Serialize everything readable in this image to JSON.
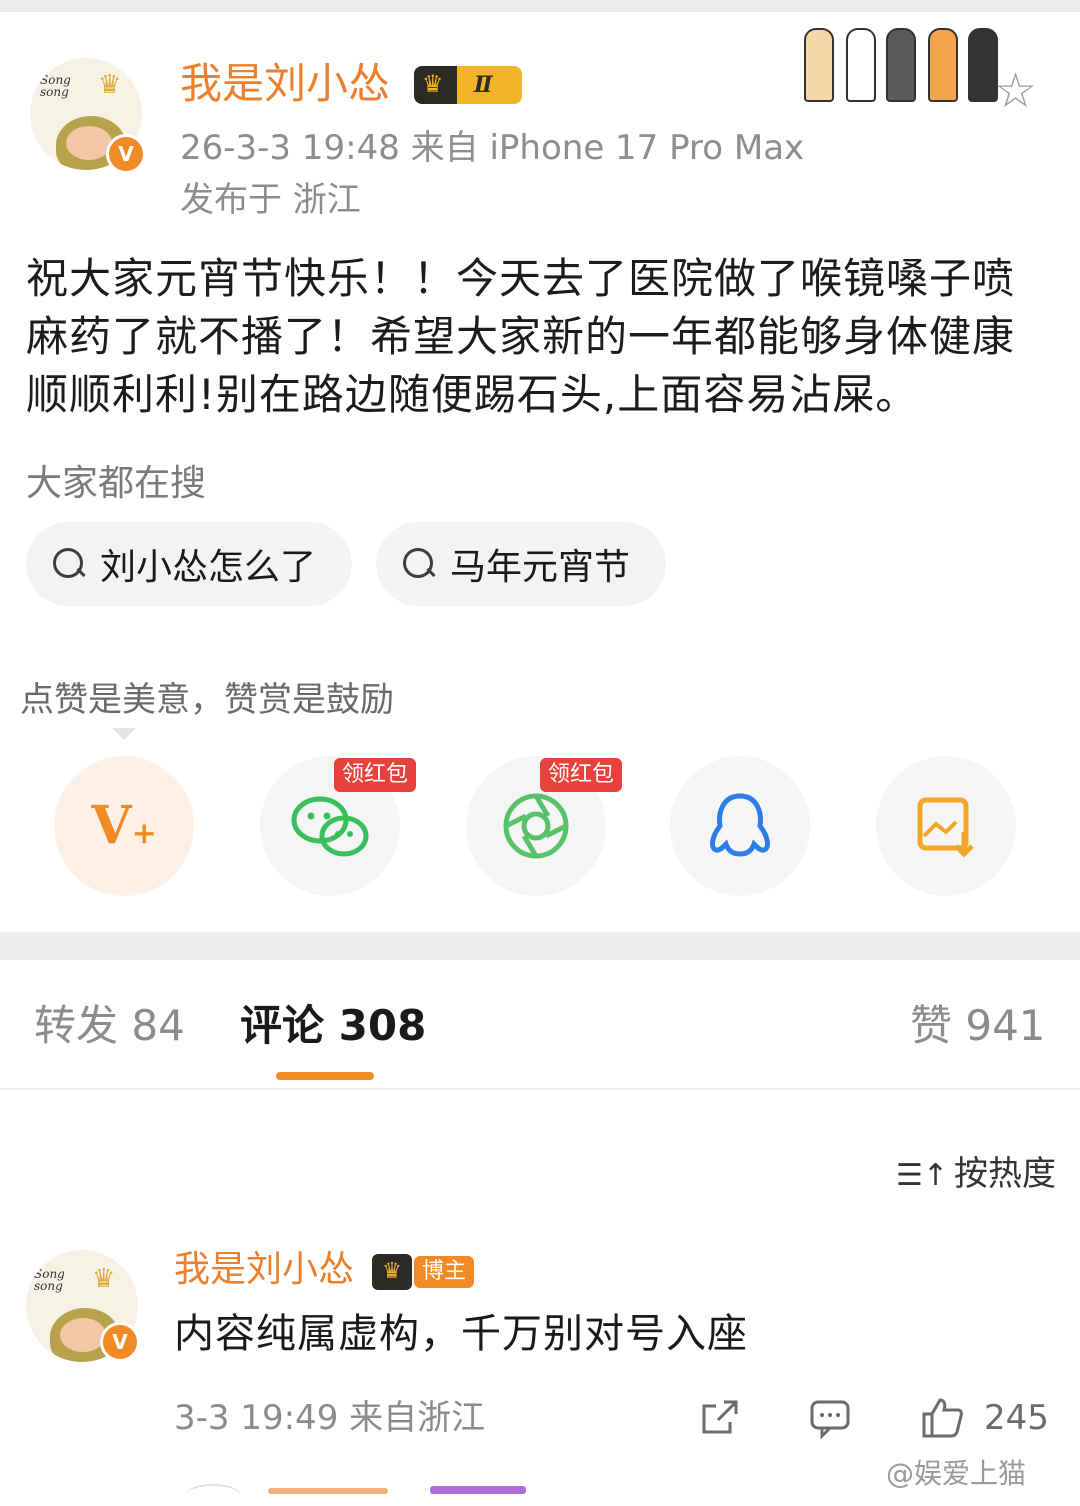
{
  "post": {
    "username": "我是刘小怂",
    "level": "Ⅱ",
    "time_source": "26-3-3 19:48  来自 iPhone 17 Pro Max",
    "location": "发布于 浙江",
    "content": "祝大家元宵节快乐！！今天去了医院做了喉镜嗓子喷麻药了就不播了！希望大家新的一年都能够身体健康顺顺利利!别在路边随便踢石头,上面容易沾屎。",
    "avatar_text": "song song"
  },
  "search": {
    "title": "大家都在搜",
    "chips": [
      "刘小怂怎么了",
      "马年元宵节"
    ]
  },
  "reward": {
    "tip": "点赞是美意，赞赏是鼓励",
    "red_packet_label": "领红包"
  },
  "share_icons": [
    "v-plus-icon",
    "wechat-icon",
    "moments-icon",
    "qq-icon",
    "save-image-icon"
  ],
  "tabs": {
    "repost": "转发 84",
    "comments": "评论 308",
    "likes": "赞 941"
  },
  "sort": {
    "label": "按热度"
  },
  "comment": {
    "username": "我是刘小怂",
    "tag": "博主",
    "text": "内容纯属虚构，千万别对号入座",
    "meta": "3-3 19:49  来自浙江",
    "likes": "245"
  },
  "watermark": "@娱爱上猫",
  "colors": {
    "accent": "#f08a24",
    "username": "#eb7f2b",
    "red_tag": "#e6413a"
  }
}
